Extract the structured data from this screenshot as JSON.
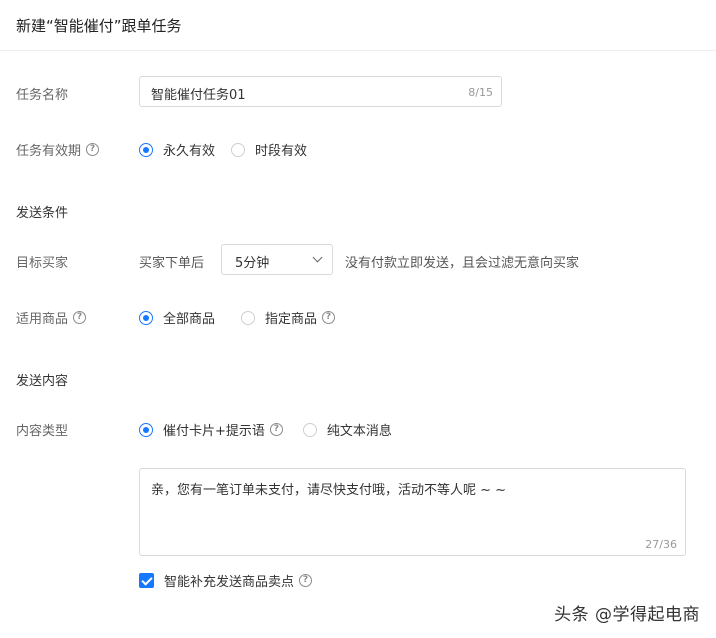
{
  "header": {
    "title": "新建“智能催付”跟单任务"
  },
  "form": {
    "task_name": {
      "label": "任务名称",
      "value": "智能催付任务01",
      "counter": "8/15"
    },
    "validity": {
      "label": "任务有效期",
      "options": [
        "永久有效",
        "时段有效"
      ],
      "selected": "永久有效"
    },
    "send_conditions": {
      "section_title": "发送条件"
    },
    "target_buyer": {
      "label": "目标买家",
      "prefix": "买家下单后",
      "delay_value": "5分钟",
      "suffix": "没有付款立即发送，且会过滤无意向买家"
    },
    "applicable_goods": {
      "label": "适用商品",
      "options": [
        "全部商品",
        "指定商品"
      ],
      "selected": "全部商品"
    },
    "send_content": {
      "section_title": "发送内容"
    },
    "content_type": {
      "label": "内容类型",
      "options": [
        "催付卡片+提示语",
        "纯文本消息"
      ],
      "selected": "催付卡片+提示语"
    },
    "message": {
      "value": "亲，您有一笔订单未支付，请尽快支付哦，活动不等人呢 ~ ~",
      "counter": "27/36"
    },
    "smart_supplement": {
      "label": "智能补充发送商品卖点",
      "checked": true
    }
  },
  "watermark": "头条 @学得起电商",
  "colors": {
    "accent": "#1677ff",
    "border": "#d9d9d9"
  },
  "icons": {
    "help": "help-circle-icon",
    "dropdown": "chevron-down-icon",
    "check": "check-icon"
  }
}
